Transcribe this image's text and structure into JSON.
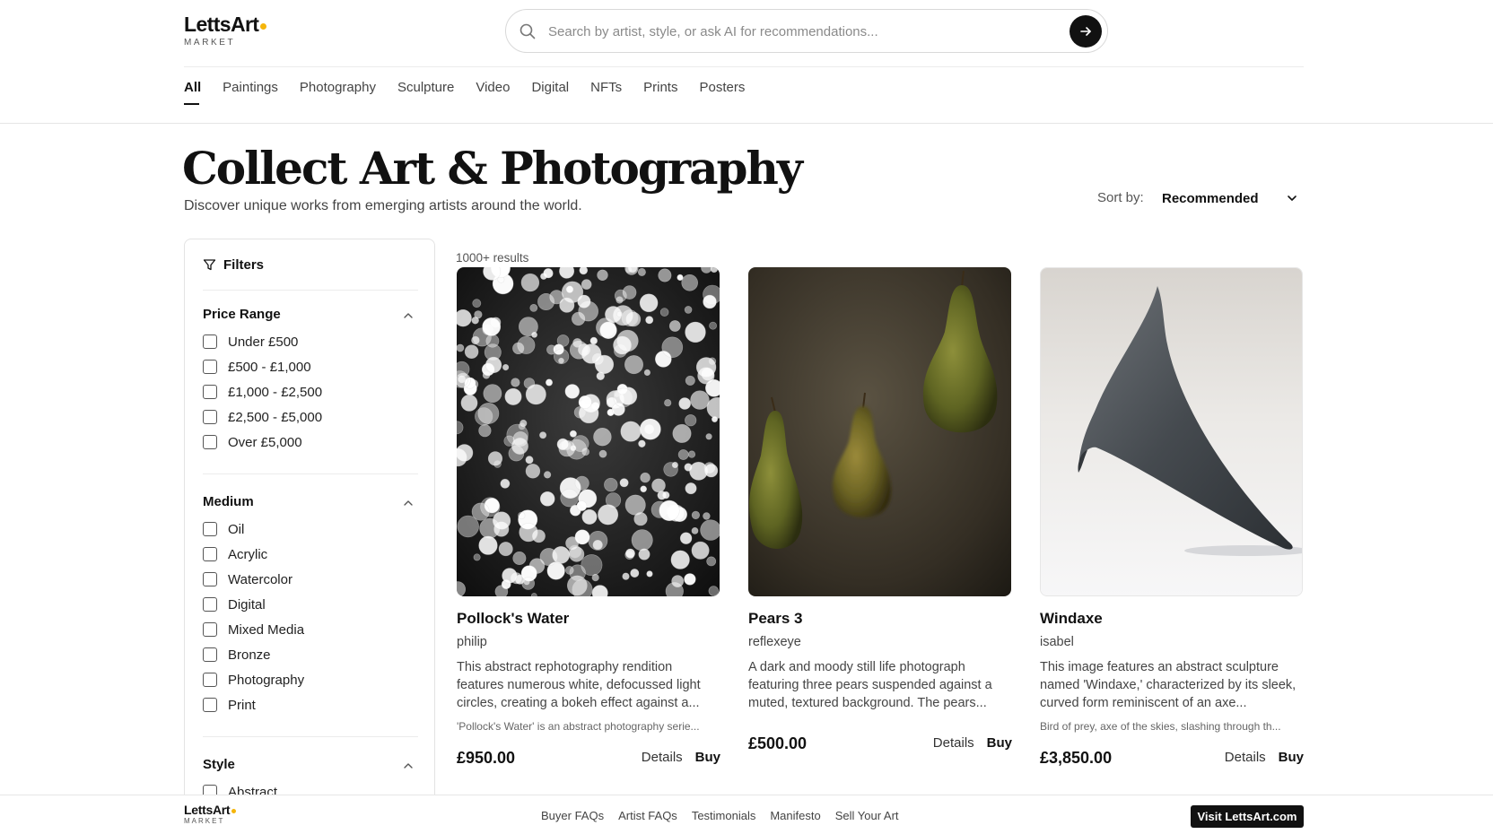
{
  "brand": {
    "name": "LettsArt",
    "sub": "MARKET",
    "dot_color": "#f5b50a"
  },
  "search": {
    "placeholder": "Search by artist, style, or ask AI for recommendations..."
  },
  "nav": {
    "tabs": [
      {
        "label": "All",
        "active": true
      },
      {
        "label": "Paintings"
      },
      {
        "label": "Photography"
      },
      {
        "label": "Sculpture"
      },
      {
        "label": "Video"
      },
      {
        "label": "Digital"
      },
      {
        "label": "NFTs"
      },
      {
        "label": "Prints"
      },
      {
        "label": "Posters"
      }
    ]
  },
  "hero": {
    "title": "Collect Art & Photography",
    "subtitle": "Discover unique works from emerging artists around the world."
  },
  "sort": {
    "label": "Sort by:",
    "value": "Recommended"
  },
  "filters": {
    "title": "Filters",
    "sections": [
      {
        "title": "Price Range",
        "options": [
          "Under £500",
          "£500 - £1,000",
          "£1,000 - £2,500",
          "£2,500 - £5,000",
          "Over £5,000"
        ]
      },
      {
        "title": "Medium",
        "options": [
          "Oil",
          "Acrylic",
          "Watercolor",
          "Digital",
          "Mixed Media",
          "Bronze",
          "Photography",
          "Print"
        ]
      },
      {
        "title": "Style",
        "options": [
          "Abstract"
        ]
      }
    ]
  },
  "results": {
    "count": "1000+ results",
    "cards": [
      {
        "title": "Pollock's Water",
        "artist": "philip",
        "description": "This abstract rephotography rendition features numerous white, defocussed light circles, creating a bokeh effect against a...",
        "note": "'Pollock's Water' is an abstract photography serie...",
        "price": "£950.00",
        "details": "Details",
        "buy": "Buy"
      },
      {
        "title": "Pears 3",
        "artist": "reflexeye",
        "description": "A dark and moody still life photograph featuring three pears suspended against a muted, textured background. The pears...",
        "price": "£500.00",
        "details": "Details",
        "buy": "Buy"
      },
      {
        "title": "Windaxe",
        "artist": "isabel",
        "description": "This image features an abstract sculpture named 'Windaxe,' characterized by its sleek, curved form reminiscent of an axe...",
        "note": "Bird of prey, axe of the skies, slashing through th...",
        "price": "£3,850.00",
        "details": "Details",
        "buy": "Buy"
      }
    ]
  },
  "footer": {
    "links": [
      "Buyer FAQs",
      "Artist FAQs",
      "Testimonials",
      "Manifesto",
      "Sell Your Art"
    ],
    "cta": "Visit LettsArt.com"
  }
}
